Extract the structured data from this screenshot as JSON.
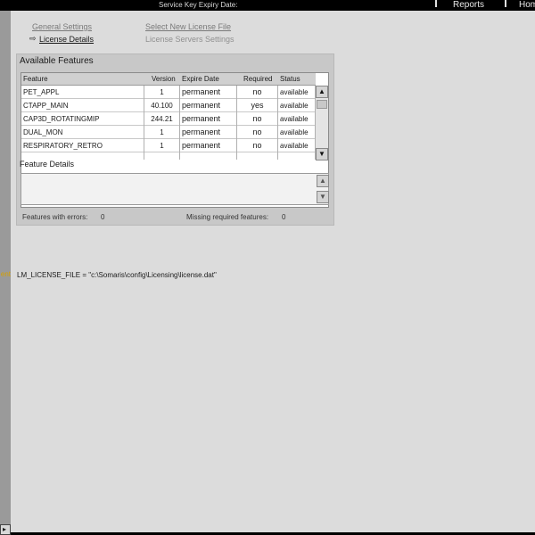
{
  "topbar": {
    "expiry_label": "Service Key Expiry Date:",
    "reports_label": "Reports",
    "home_label": "Hom"
  },
  "leftcut_text": "ent",
  "bottom_arrow": "▸",
  "links": {
    "general_settings": "General Settings",
    "license_details": "License Details",
    "select_new_license": "Select New License File",
    "license_servers": "License Servers Settings",
    "active_arrow": "⇨"
  },
  "features": {
    "title": "Available Features",
    "columns": [
      "Feature",
      "Version",
      "Expire Date",
      "Required",
      "Status"
    ],
    "rows": [
      {
        "feature": "PET_APPL",
        "version": "1",
        "expire": "permanent",
        "required": "no",
        "status": "available"
      },
      {
        "feature": "CTAPP_MAIN",
        "version": "40.100",
        "expire": "permanent",
        "required": "yes",
        "status": "available"
      },
      {
        "feature": "CAP3D_ROTATINGMIP",
        "version": "244.21",
        "expire": "permanent",
        "required": "no",
        "status": "available"
      },
      {
        "feature": "DUAL_MON",
        "version": "1",
        "expire": "permanent",
        "required": "no",
        "status": "available"
      },
      {
        "feature": "RESPIRATORY_RETRO",
        "version": "1",
        "expire": "permanent",
        "required": "no",
        "status": "available"
      }
    ]
  },
  "details": {
    "title": "Feature Details"
  },
  "summary": {
    "errors_label": "Features with errors:",
    "errors_value": "0",
    "missing_label": "Missing required features:",
    "missing_value": "0"
  },
  "license_file": "LM_LICENSE_FILE = \"c:\\Somaris\\config\\Licensing\\license.dat\""
}
